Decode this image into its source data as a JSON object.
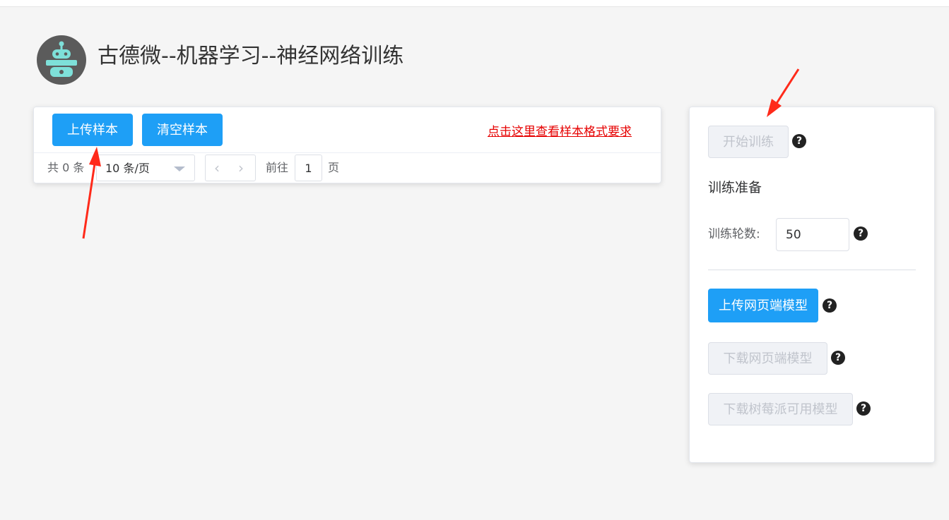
{
  "header": {
    "title": "古德微--机器学习--神经网络训练",
    "logo_icon": "robot-icon"
  },
  "samples": {
    "upload_label": "上传样本",
    "clear_label": "清空样本",
    "format_link": "点击这里查看样本格式要求"
  },
  "pagination": {
    "total_text": "共 0 条",
    "page_size": "10 条/页",
    "goto_label": "前往",
    "current_page": "1",
    "page_suffix": "页"
  },
  "training": {
    "start_label": "开始训练",
    "prep_title": "训练准备",
    "epochs_label": "训练轮数:",
    "epochs_value": "50",
    "upload_model_label": "上传网页端模型",
    "download_web_label": "下载网页端模型",
    "download_pi_label": "下载树莓派可用模型"
  },
  "colors": {
    "primary": "#1e9ff6",
    "link": "#e60000",
    "annotation_arrow": "#ff2a1a"
  }
}
